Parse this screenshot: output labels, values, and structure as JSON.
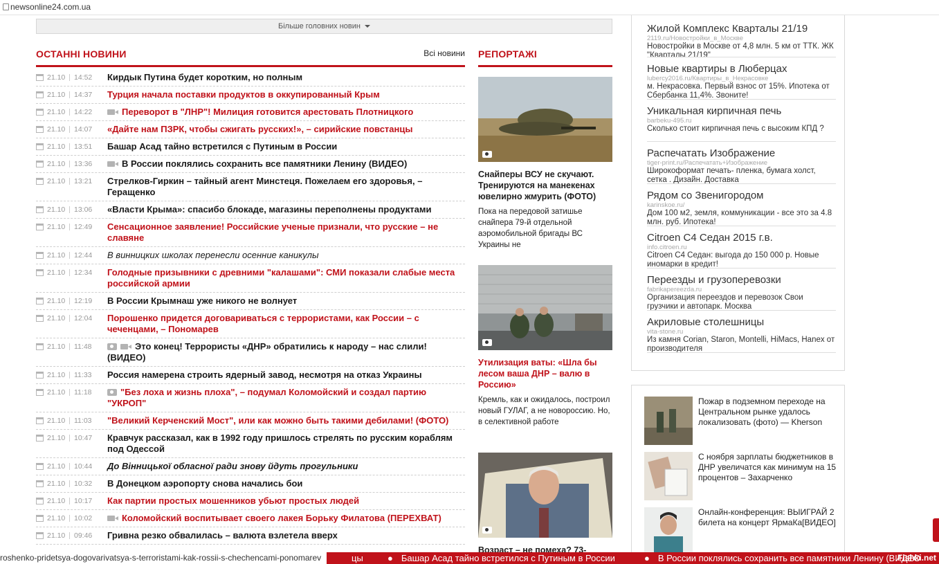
{
  "browser": {
    "url": "newsonline24.com.ua"
  },
  "more_bar": {
    "label": "Більше головних новин"
  },
  "latest": {
    "heading": "ОСТАННІ НОВИНИ",
    "all_link": "Всі новини",
    "items": [
      {
        "date": "21.10",
        "time": "14:52",
        "title": "Кирдык Путина будет коротким, но полным",
        "style": "bold",
        "icons": []
      },
      {
        "date": "21.10",
        "time": "14:37",
        "title": "Турция начала поставки продуктов в оккупированный Крым",
        "style": "red",
        "icons": []
      },
      {
        "date": "21.10",
        "time": "14:22",
        "title": "Переворот в \"ЛНР\"! Милиция готовится арестовать Плотницкого",
        "style": "red",
        "icons": [
          "video"
        ]
      },
      {
        "date": "21.10",
        "time": "14:07",
        "title": "«Дайте нам ПЗРК, чтобы сжигать русских!», – сирийские повстанцы",
        "style": "red",
        "icons": []
      },
      {
        "date": "21.10",
        "time": "13:51",
        "title": "Башар Асад тайно встретился с Путиным в России",
        "style": "bold",
        "icons": []
      },
      {
        "date": "21.10",
        "time": "13:36",
        "title": "В России поклялись сохранить все памятники Ленину (ВИДЕО)",
        "style": "bold",
        "icons": [
          "video"
        ]
      },
      {
        "date": "21.10",
        "time": "13:21",
        "title": "Стрелков-Гиркин – тайный агент Минстеця. Пожелаем его здоровья, – Геращенко",
        "style": "bold",
        "icons": []
      },
      {
        "date": "21.10",
        "time": "13:06",
        "title": "«Власти Крыма»: спасибо блокаде, магазины переполнены продуктами",
        "style": "bold",
        "icons": []
      },
      {
        "date": "21.10",
        "time": "12:49",
        "title": "Сенсационное заявление! Российские ученые признали, что русские – не славяне",
        "style": "red",
        "icons": []
      },
      {
        "date": "21.10",
        "time": "12:44",
        "title": "В винницких школах перенесли осенние каникулы",
        "style": "italic",
        "icons": []
      },
      {
        "date": "21.10",
        "time": "12:34",
        "title": "Голодные призывники с древними \"калашами\": СМИ показали слабые места российской армии",
        "style": "red",
        "icons": []
      },
      {
        "date": "21.10",
        "time": "12:19",
        "title": "В России Крымнаш уже никого не волнует",
        "style": "bold",
        "icons": []
      },
      {
        "date": "21.10",
        "time": "12:04",
        "title": "Порошенко придется договариваться с террористами, как России – с чеченцами, – Пономарев",
        "style": "red",
        "icons": []
      },
      {
        "date": "21.10",
        "time": "11:48",
        "title": "Это конец! Террористы «ДНР» обратились к народу – нас слили! (ВИДЕО)",
        "style": "bold",
        "icons": [
          "photo",
          "video"
        ]
      },
      {
        "date": "21.10",
        "time": "11:33",
        "title": "Россия намерена строить ядерный завод, несмотря на отказ Украины",
        "style": "bold",
        "icons": []
      },
      {
        "date": "21.10",
        "time": "11:18",
        "title": "\"Без лоха и жизнь плоха\", – подумал Коломойский и создал партию \"УКРОП\"",
        "style": "red",
        "icons": [
          "photo"
        ]
      },
      {
        "date": "21.10",
        "time": "11:03",
        "title": "\"Великий Керченский Мост\", или как можно быть такими дебилами! (ФОТО)",
        "style": "red",
        "icons": []
      },
      {
        "date": "21.10",
        "time": "10:47",
        "title": "Кравчук рассказал, как в 1992 году пришлось стрелять по русским кораблям под Одессой",
        "style": "bold",
        "icons": []
      },
      {
        "date": "21.10",
        "time": "10:44",
        "title": "До Вінницької обласної ради знову йдуть прогульники",
        "style": "bolditalic",
        "icons": []
      },
      {
        "date": "21.10",
        "time": "10:32",
        "title": "В Донецком аэропорту снова начались бои",
        "style": "bold",
        "icons": []
      },
      {
        "date": "21.10",
        "time": "10:17",
        "title": "Как партии простых мошенников убьют простых людей",
        "style": "red",
        "icons": []
      },
      {
        "date": "21.10",
        "time": "10:02",
        "title": "Коломойский воспитывает своего лакея Борьку Филатова (ПЕРЕХВАТ)",
        "style": "red",
        "icons": [
          "video"
        ]
      },
      {
        "date": "21.10",
        "time": "09:46",
        "title": "Гривна резко обвалилась – валюта взлетела вверх",
        "style": "bold",
        "icons": []
      }
    ]
  },
  "reports": {
    "heading": "РЕПОРТАЖІ",
    "items": [
      {
        "title": "Снайперы ВСУ не скучают. Тренируются на манекенах ювелирно жмурить (ФОТО)",
        "desc": "Пока на передовой затишье снайпера 79-й отдельной аэромобильной бригады ВС Украины не",
        "red": false
      },
      {
        "title": "Утилизация ваты: «Шла бы лесом ваша ДНР – валю в Россию»",
        "desc": "Кремль, как и ожидалось, построил новый ГУЛАГ, а не новороссию. Но, в селективной работе",
        "red": true
      },
      {
        "title": "Возраст – не помеха? 73-",
        "desc": "",
        "red": false
      }
    ]
  },
  "ads": [
    {
      "title": "Жилой Комплекс Кварталы 21/19",
      "url": "2119.ru/Новостройки_в_Москве",
      "desc": "Новостройки в Москве от 4,8 млн. 5 км от ТТК. ЖК \"Кварталы 21/19\""
    },
    {
      "title": "Новые квартиры в Люберцах",
      "url": "lubercy2016.ru/Квартиры_в_Некрасовке",
      "desc": "м. Некрасовка. Первый взнос от 15%. Ипотека от Сбербанка 11,4%. Звоните!"
    },
    {
      "title": "Уникальная кирпичная печь",
      "url": "barbeku-495.ru",
      "desc": "Сколько стоит кирпичная печь с высоким КПД ?"
    },
    {
      "title": "Распечатать Изображение",
      "url": "tiger-print.ru/Распечатать+Изображение",
      "desc": "Широкоформат печать- пленка, бумага холст, сетка . Дизайн. Доставка"
    },
    {
      "title": "Рядом со Звенигородом",
      "url": "karinskoe.ru/",
      "desc": "Дом 100 м2, земля, коммуникации - все это за 4.8 млн. руб. Ипотека!"
    },
    {
      "title": "Citroen C4 Седан 2015 г.в.",
      "url": "info.citroen.ru",
      "desc": "Citroen C4 Седан: выгода до 150 000 р. Новые иномарки в кредит!"
    },
    {
      "title": "Переезды и грузоперевозки",
      "url": "fabrikapereezda.ru",
      "desc": "Организация переездов и перевозок Свои грузчики и автопарк. Москва"
    },
    {
      "title": "Акриловые столешницы",
      "url": "vita-stone.ru",
      "desc": "Из камня Corian, Staron, Montelli, HiMacs, Hanex от производителя"
    }
  ],
  "related": [
    {
      "text": "Пожар в подземном переходе на Центральном рынке удалось локализовать (фото) — Kherson"
    },
    {
      "text": "С ноября зарплаты бюджетников в ДНР увеличатся как минимум на 15 процентов – Захарченко"
    },
    {
      "text": "Онлайн-конференция: ВЫИГРАЙ 2 билета на концерт ЯрмаКа[ВИДЕО]"
    }
  ],
  "ticker": {
    "slug": "roshenko-pridetsya-dogovarivatsya-s-terroristami-kak-rossii-s-chechencami-ponomarev",
    "items": [
      "цы",
      "Башар Асад тайно встретился с Путиным в России",
      "В России поклялись сохранить все памятники Ленину (ВИДЕО"
    ],
    "watermark": "Fishki.net"
  },
  "colors": {
    "accent": "#c0121a",
    "text": "#1a1a1a",
    "meta": "#999999"
  }
}
